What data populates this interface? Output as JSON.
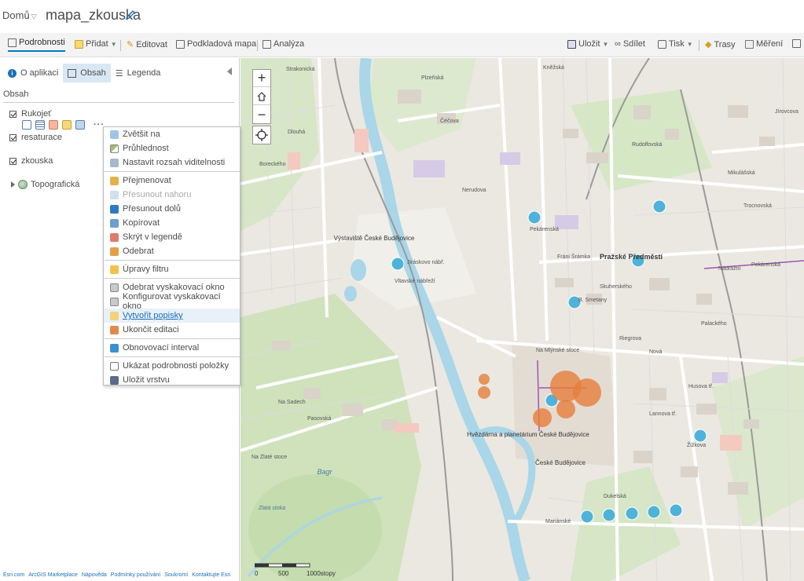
{
  "header": {
    "home_label": "Domů",
    "map_title": "mapa_zkouska"
  },
  "toolbar": {
    "details": "Podrobnosti",
    "add": "Přidat",
    "edit": "Editovat",
    "basemap": "Podkladová mapa",
    "analysis": "Analýza",
    "save": "Uložit",
    "share": "Sdílet",
    "print": "Tisk",
    "routes": "Trasy",
    "measure": "Měření"
  },
  "panel": {
    "tabs": [
      "O aplikaci",
      "Obsah",
      "Legenda"
    ],
    "section_title": "Obsah",
    "layers": [
      "Rukojeť",
      "resaturace",
      "zkouska"
    ],
    "basemap_layer": "Topografická"
  },
  "context_menu": {
    "items": [
      "Zvětšit na",
      "Průhlednost",
      "Nastavit rozsah viditelnosti",
      "Přejmenovat",
      "Přesunout nahoru",
      "Přesunout dolů",
      "Kopírovat",
      "Skrýt v legendě",
      "Odebrat",
      "Úpravy filtru",
      "Odebrat vyskakovací okno",
      "Konfigurovat vyskakovací okno",
      "Vytvořit popisky",
      "Ukončit editaci",
      "Obnovovací interval",
      "Ukázat podrobnosti položky",
      "Uložit vrstvu"
    ]
  },
  "footer": {
    "links": [
      "Esri.com",
      "ArcGIS Marketplace",
      "Nápověda",
      "Podmínky používání",
      "Soukromí",
      "Kontaktujte Esri"
    ]
  },
  "map": {
    "labels": {
      "vystaviste": "Výstaviště České Budějovice",
      "prazske": "Pražské Předměstí",
      "hvezdarna": "Hvězdárna a planetárium České Budějovice",
      "ceske": "České Budějovice",
      "bagr": "Bagr",
      "zlata": "Zlatá stoka"
    },
    "streets": [
      "Strakonická",
      "Plzeňská",
      "Čéčova",
      "Nerudova",
      "Pekárenská",
      "Fráni Šrámka",
      "B. Smetany",
      "Skuherského",
      "Riegrova",
      "Nová",
      "Na Sadech",
      "Pasovská",
      "Na Zlaté stoce",
      "Mariánské",
      "Žižkova",
      "Lannova tř.",
      "Husova tř.",
      "Na Mlýnské stoce",
      "Dukelská",
      "Nádražní",
      "Pekárenská",
      "Boreckého",
      "Mikulášská",
      "Trocnovská",
      "Jírovcova",
      "Dlouhá",
      "Vltavské nábřeží",
      "Jiráskovo nábř.",
      "Kněžská",
      "Rudolfovská",
      "Palackého"
    ],
    "scale": {
      "labels": [
        "0",
        "500",
        "1000stopy"
      ]
    }
  },
  "colors": {
    "accent": "#007ac2",
    "blue_point": "#4fb3d9",
    "orange_point": "#e67e3c",
    "water": "#a9d6e8",
    "green": "#c8dfb5"
  }
}
